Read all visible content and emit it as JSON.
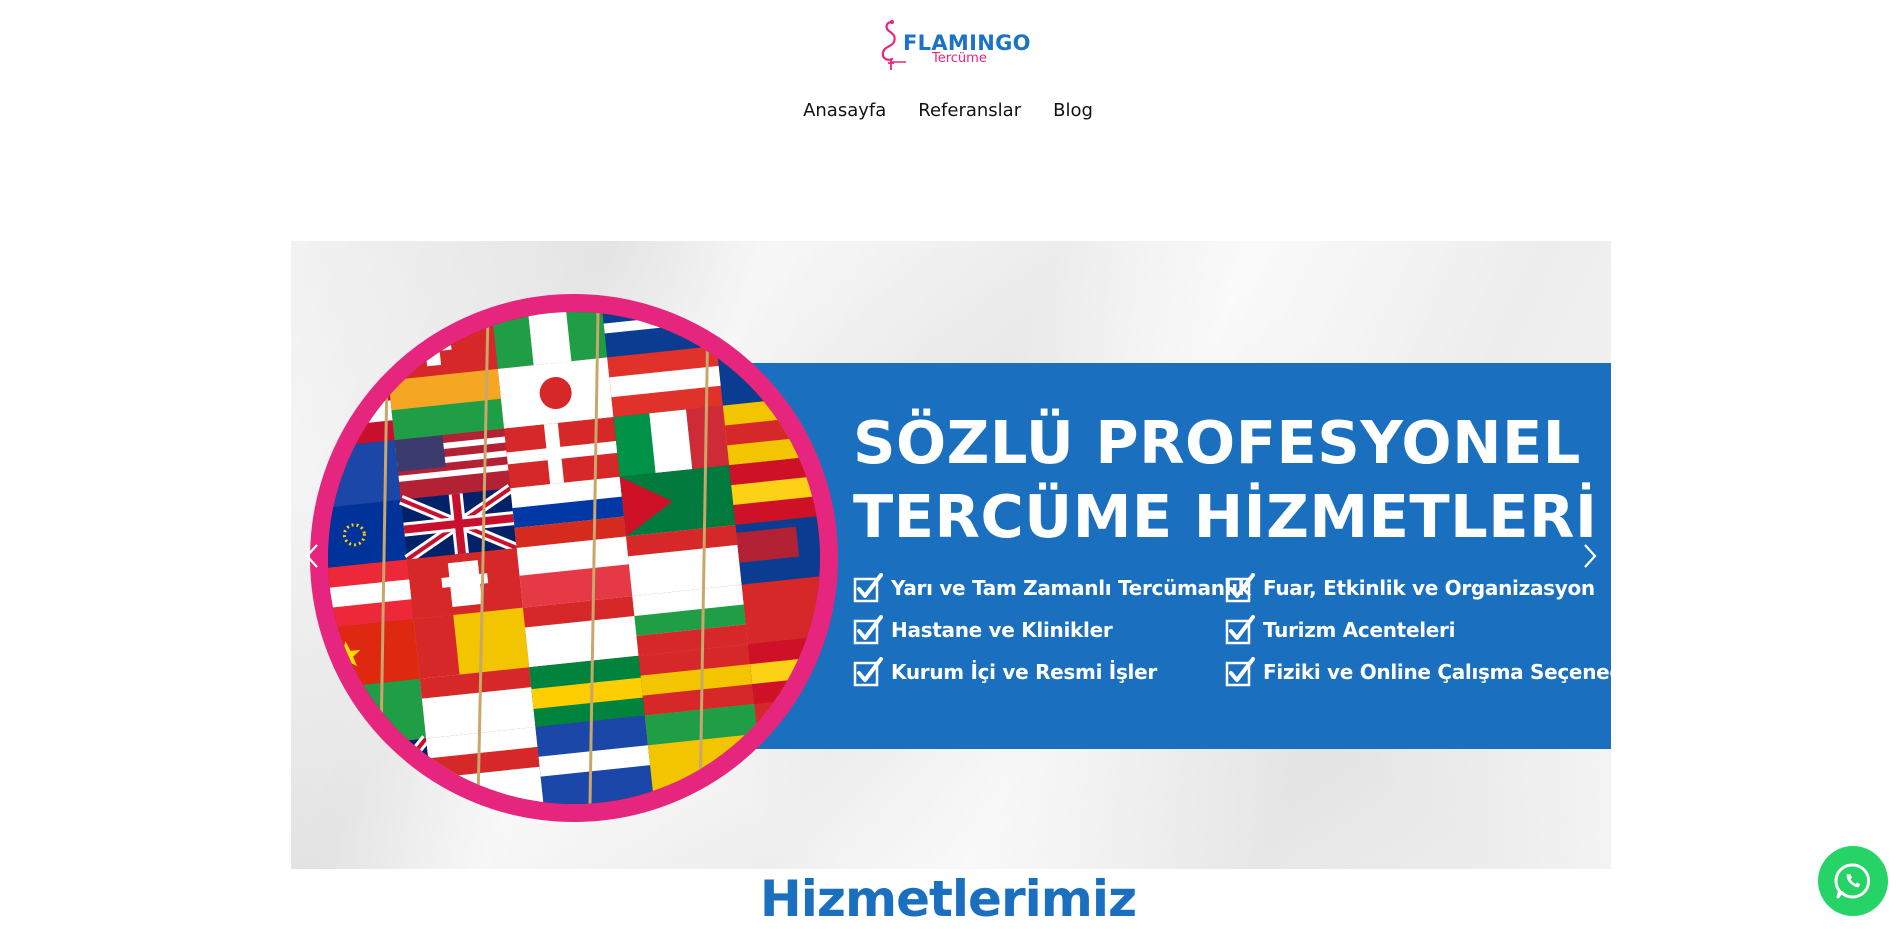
{
  "brand": {
    "name": "FLAMINGO",
    "tagline": "Tercüme",
    "colors": {
      "blue": "#1b6fbf",
      "pink": "#e6267e"
    },
    "icon": "flamingo-logo-icon"
  },
  "nav": {
    "items": [
      {
        "label": "Anasayfa"
      },
      {
        "label": "Referanslar"
      },
      {
        "label": "Blog"
      }
    ]
  },
  "slider": {
    "slide": {
      "title_line1": "SÖZLÜ PROFESYONEL",
      "title_line2": "TERCÜME HİZMETLERİ",
      "features": [
        "Yarı ve Tam Zamanlı Tercümanlık",
        "Fuar, Etkinlik ve Organizasyon",
        "Hastane ve Klinikler",
        "Turizm Acenteleri",
        "Kurum İçi ve Resmi İşler",
        "Fiziki ve Online Çalışma Seçeneği"
      ],
      "image": "world-flags-photo",
      "band_color": "#1b6fbf",
      "ring_color": "#e6267e"
    },
    "prev_icon": "chevron-left-icon",
    "next_icon": "chevron-right-icon"
  },
  "section": {
    "title": "Hizmetlerimiz"
  },
  "whatsapp": {
    "icon": "whatsapp-icon",
    "color": "#25d366"
  }
}
